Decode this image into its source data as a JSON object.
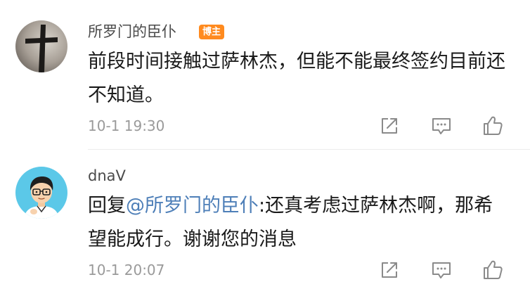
{
  "comments": [
    {
      "username": "所罗门的臣仆",
      "badge": "博主",
      "text": "前段时间接触过萨林杰，但能不能最终签约目前还不知道。",
      "time": "10-1 19:30",
      "avatar_icon": "cross-avatar-icon"
    },
    {
      "username": "dnaV",
      "reply_prefix": "回复",
      "mention": "@所罗门的臣仆",
      "text": ":还真考虑过萨林杰啊，那希望能成行。谢谢您的消息",
      "time": "10-1 20:07",
      "avatar_icon": "cartoon-person-avatar-icon"
    }
  ],
  "colors": {
    "badge": "#ff8a1e",
    "mention": "#4e7fb8",
    "text": "#1a1a1a",
    "muted": "#9a9a9a",
    "username": "#4a4a4a"
  },
  "icons": [
    "share-icon",
    "comment-icon",
    "like-icon"
  ]
}
